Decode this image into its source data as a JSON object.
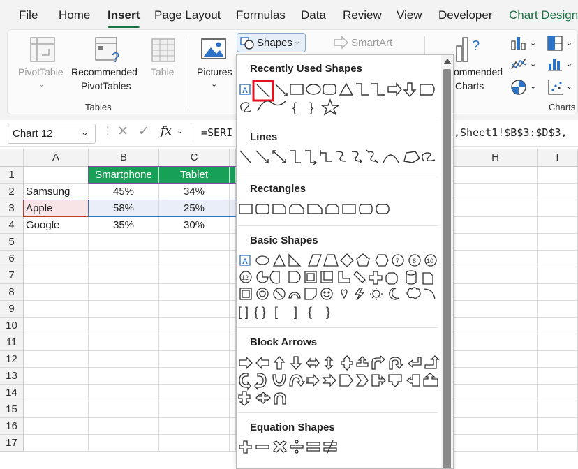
{
  "tabs": [
    "File",
    "Home",
    "Insert",
    "Page Layout",
    "Formulas",
    "Data",
    "Review",
    "View",
    "Developer",
    "Chart Design"
  ],
  "ribbon": {
    "pivot_table": "PivotTable",
    "recommended_pivot_1": "Recommended",
    "recommended_pivot_2": "PivotTables",
    "table": "Table",
    "tables_group": "Tables",
    "pictures": "Pictures",
    "shapes": "Shapes",
    "smartart": "SmartArt",
    "recommended_charts_1": "ommended",
    "recommended_charts_2": "Charts",
    "charts_group": "Charts"
  },
  "formula_bar": {
    "name_box": "Chart 12",
    "fx": "fx",
    "formula_left": "=SERI",
    "formula_right": ",Sheet1!$B$3:$D$3,"
  },
  "columns": [
    "A",
    "B",
    "C",
    "H",
    "I"
  ],
  "rows": [
    "1",
    "2",
    "3",
    "4",
    "5",
    "6",
    "7",
    "8",
    "9",
    "10",
    "11",
    "12",
    "13",
    "14",
    "15",
    "16",
    "17"
  ],
  "sheet": {
    "headers": [
      "Smartphone",
      "Tablet"
    ],
    "data": [
      {
        "name": "Samsung",
        "b": "45%",
        "c": "34%"
      },
      {
        "name": "Apple",
        "b": "58%",
        "c": "25%"
      },
      {
        "name": "Google",
        "b": "35%",
        "c": "30%"
      }
    ]
  },
  "dropdown": {
    "recent": "Recently Used Shapes",
    "lines": "Lines",
    "rectangles": "Rectangles",
    "basic": "Basic Shapes",
    "block_arrows": "Block Arrows",
    "equation": "Equation Shapes",
    "highlight_color": "#e81123"
  }
}
